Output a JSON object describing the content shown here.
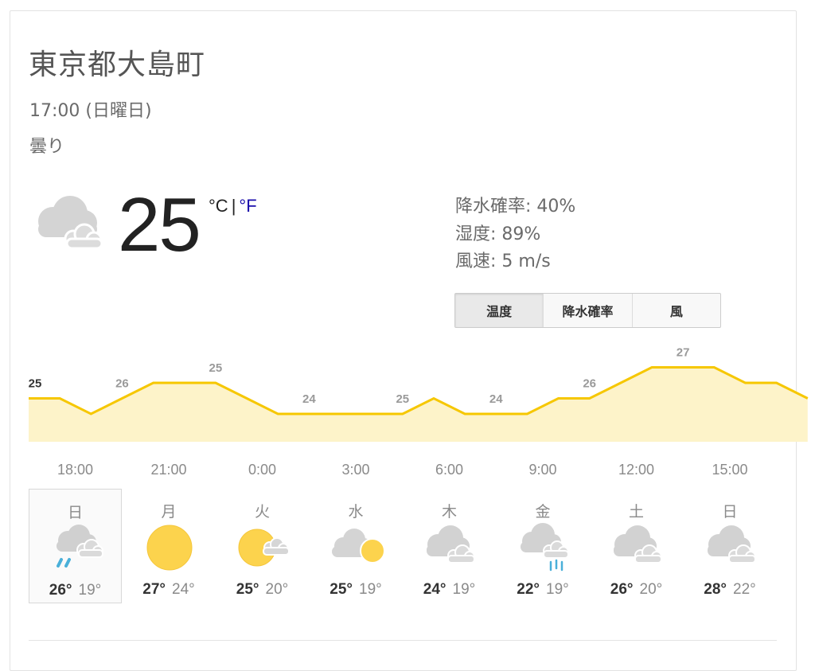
{
  "location": "東京都大島町",
  "datetime": "17:00 (日曜日)",
  "condition": "曇り",
  "current": {
    "temperature": "25",
    "unit_c": "°C",
    "unit_sep": "|",
    "unit_f": "°F",
    "icon": "cloudy-icon"
  },
  "stats": {
    "precip": "降水確率: 40%",
    "humidity": "湿度: 89%",
    "wind": "風速: 5 m/s"
  },
  "tabs": [
    "温度",
    "降水確率",
    "風"
  ],
  "colors": {
    "chart_line": "#f6c700",
    "chart_fill": "#fdf3c9",
    "link": "#1a0dab",
    "sun": "#fcd34d",
    "rain": "#4ab0d9"
  },
  "chart_data": {
    "type": "area",
    "x": [
      "17:00",
      "18:00",
      "19:00",
      "20:00",
      "21:00",
      "22:00",
      "23:00",
      "0:00",
      "1:00",
      "2:00",
      "3:00",
      "4:00",
      "5:00",
      "6:00",
      "7:00",
      "8:00",
      "9:00",
      "10:00",
      "11:00",
      "12:00",
      "13:00",
      "14:00",
      "15:00",
      "16:00",
      "17:00"
    ],
    "values": [
      25,
      25,
      24,
      25,
      26,
      26,
      26,
      25,
      24,
      24,
      24,
      24,
      24,
      25,
      24,
      24,
      24,
      25,
      25,
      26,
      27,
      27,
      27,
      26,
      26,
      25
    ],
    "labels": [
      {
        "text": "25",
        "i": 0,
        "bold": true
      },
      {
        "text": "26",
        "i": 3
      },
      {
        "text": "25",
        "i": 6
      },
      {
        "text": "24",
        "i": 9
      },
      {
        "text": "25",
        "i": 12
      },
      {
        "text": "24",
        "i": 15
      },
      {
        "text": "26",
        "i": 18
      },
      {
        "text": "27",
        "i": 21
      }
    ],
    "ticks": [
      "18:00",
      "21:00",
      "0:00",
      "3:00",
      "6:00",
      "9:00",
      "12:00",
      "15:00"
    ]
  },
  "days": [
    {
      "name": "日",
      "high": "26°",
      "low": "19°",
      "icon": "rain-cloud-icon"
    },
    {
      "name": "月",
      "high": "27°",
      "low": "24°",
      "icon": "sun-icon"
    },
    {
      "name": "火",
      "high": "25°",
      "low": "20°",
      "icon": "partly-sunny-icon"
    },
    {
      "name": "水",
      "high": "25°",
      "low": "19°",
      "icon": "sun-behind-cloud-icon"
    },
    {
      "name": "木",
      "high": "24°",
      "low": "19°",
      "icon": "cloudy-icon"
    },
    {
      "name": "金",
      "high": "22°",
      "low": "19°",
      "icon": "showers-icon"
    },
    {
      "name": "土",
      "high": "26°",
      "low": "20°",
      "icon": "cloudy-icon"
    },
    {
      "name": "日",
      "high": "28°",
      "low": "22°",
      "icon": "cloudy-icon"
    }
  ]
}
